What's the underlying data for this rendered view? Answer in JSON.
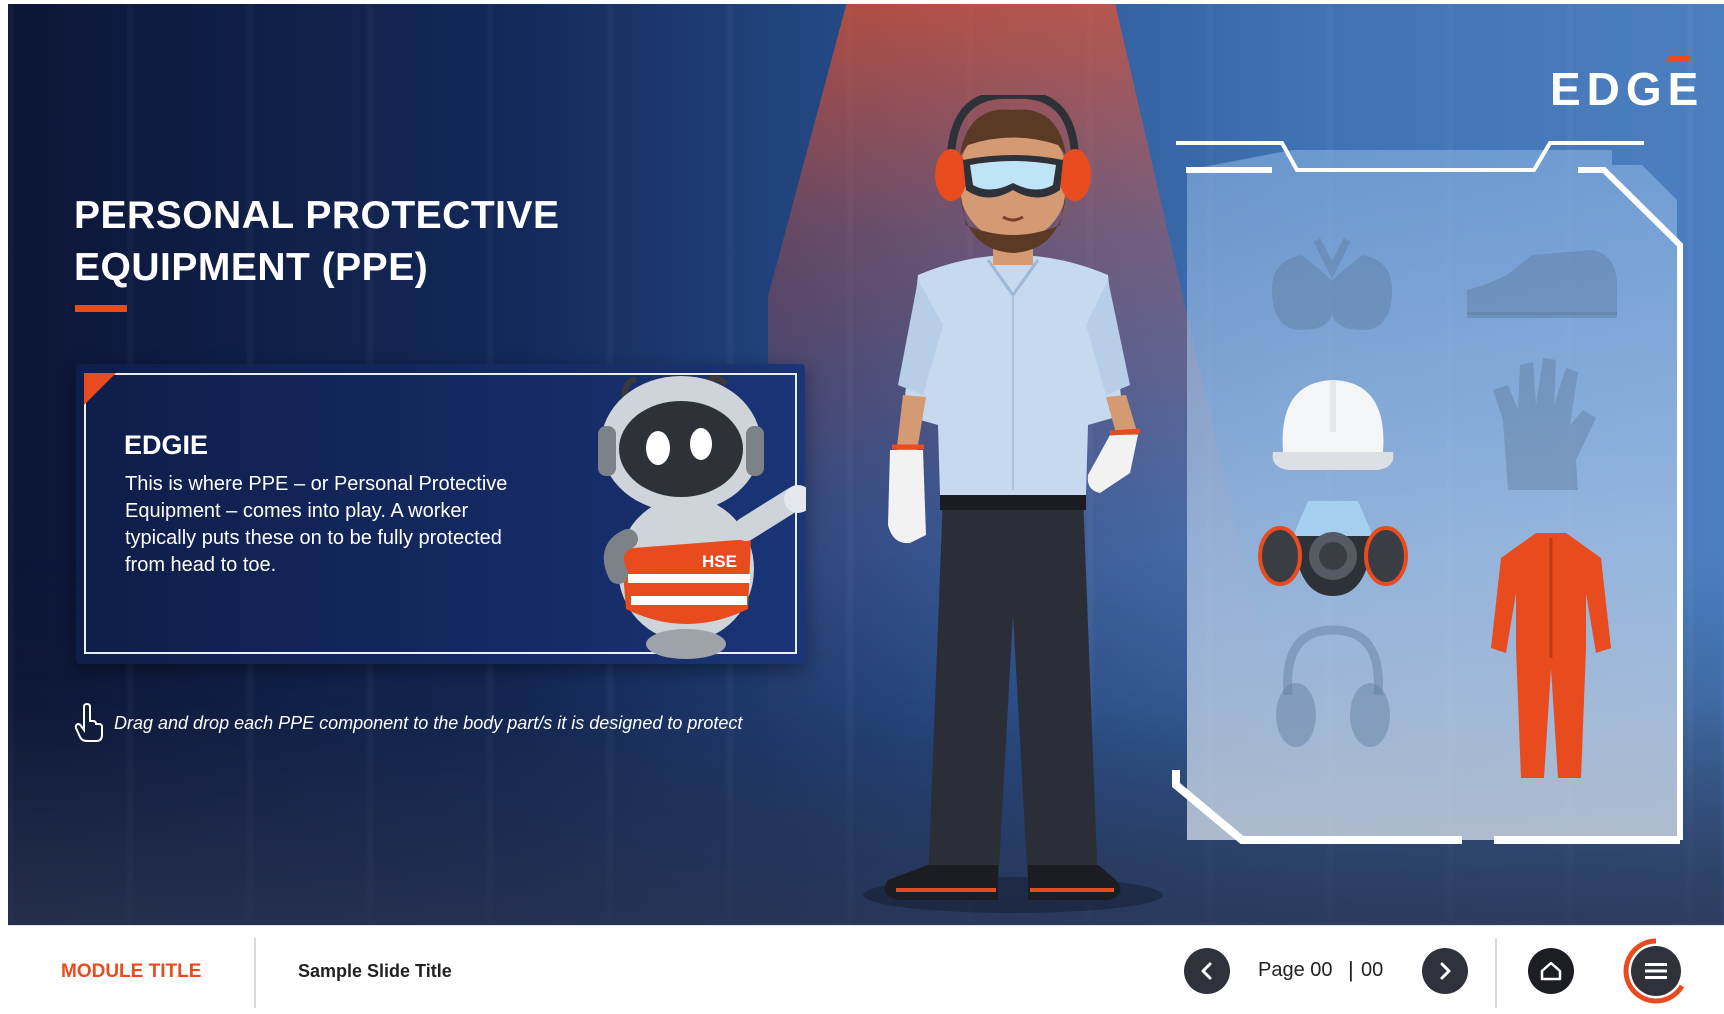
{
  "brand": {
    "logo_text": "EDGE"
  },
  "header": {
    "title_line1": "PERSONAL PROTECTIVE",
    "title_line2": "EQUIPMENT (PPE)"
  },
  "edgie": {
    "heading": "EDGIE",
    "body": "This is where PPE – or Personal Protective Equipment – comes into play. A worker typically puts these on to be fully protected from head to toe.",
    "vest_label": "HSE"
  },
  "instruction": {
    "text": "Drag and drop each PPE component to the body part/s it is designed to protect"
  },
  "ppe_items": [
    {
      "name": "safety goggles",
      "state": "placed"
    },
    {
      "name": "safety boots",
      "state": "placed"
    },
    {
      "name": "hard hat",
      "state": "available"
    },
    {
      "name": "gloves",
      "state": "placed"
    },
    {
      "name": "respirator mask",
      "state": "available"
    },
    {
      "name": "coveralls",
      "state": "available"
    },
    {
      "name": "ear muffs",
      "state": "placed"
    }
  ],
  "footer": {
    "module_title": "MODULE TITLE",
    "slide_title": "Sample Slide Title",
    "page_label": "Page 00",
    "page_separator": "|",
    "page_total": "00"
  },
  "colors": {
    "accent": "#e84b1d",
    "navy": "#0f1d49",
    "nav_button": "#2f323a"
  },
  "icons": [
    "hand-pointer-icon",
    "chevron-left-icon",
    "chevron-right-icon",
    "home-icon",
    "hamburger-menu-icon"
  ]
}
